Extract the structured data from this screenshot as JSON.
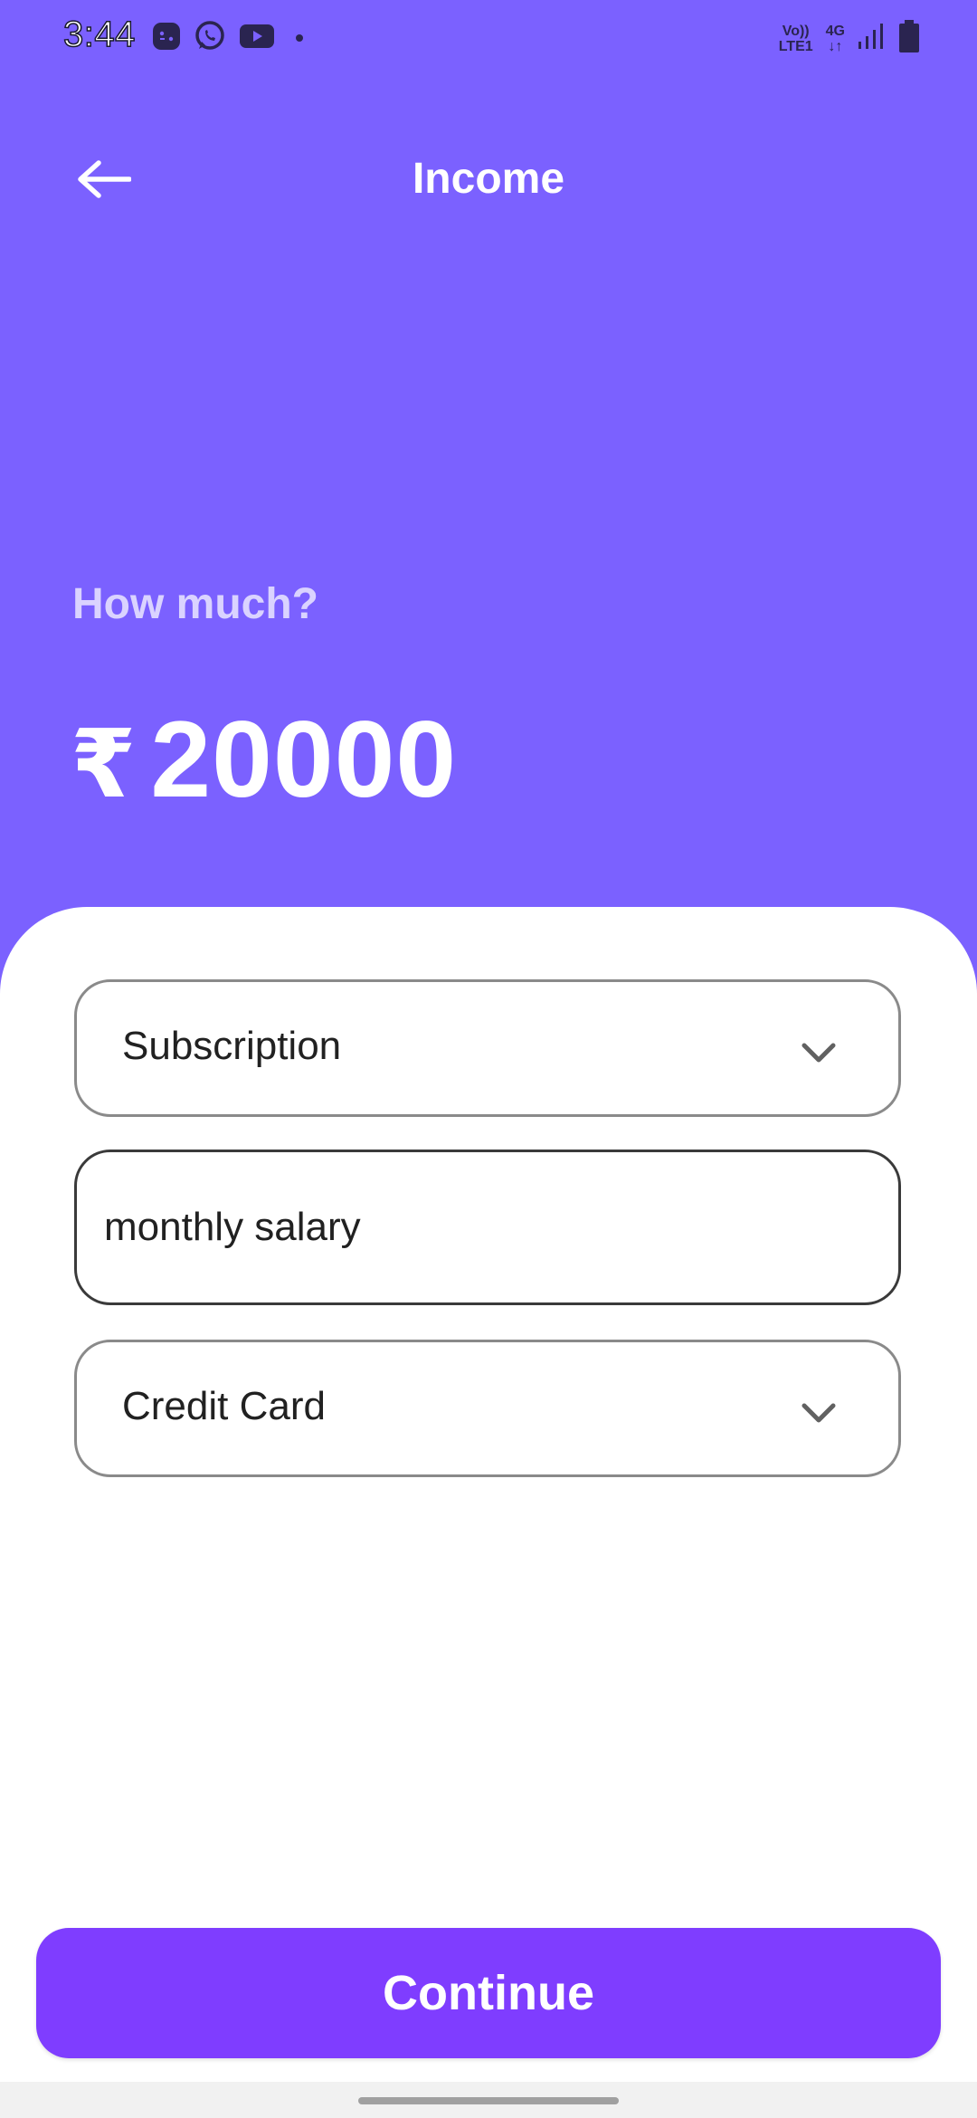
{
  "status_bar": {
    "time": "3:44",
    "left_icons": [
      "game-controller-icon",
      "whatsapp-icon",
      "youtube-icon",
      "dot-icon"
    ],
    "volte_top": "Vo))",
    "volte_bottom": "LTE1",
    "network_top": "4G",
    "network_bottom": "↓↑",
    "right_icons": [
      "signal-icon",
      "battery-icon"
    ]
  },
  "app_bar": {
    "title": "Income",
    "back_icon": "arrow-left-icon"
  },
  "amount": {
    "prompt": "How much?",
    "currency_symbol": "₹",
    "value": "20000"
  },
  "form": {
    "category_select": {
      "selected": "Subscription",
      "icon": "chevron-down-icon"
    },
    "description_input": {
      "value": "monthly salary"
    },
    "wallet_select": {
      "selected": "Credit Card",
      "icon": "chevron-down-icon"
    }
  },
  "actions": {
    "continue_label": "Continue"
  },
  "colors": {
    "header_background": "#7B61FF",
    "primary_button": "#7F3DFF",
    "sheet_background": "#FFFFFF"
  }
}
